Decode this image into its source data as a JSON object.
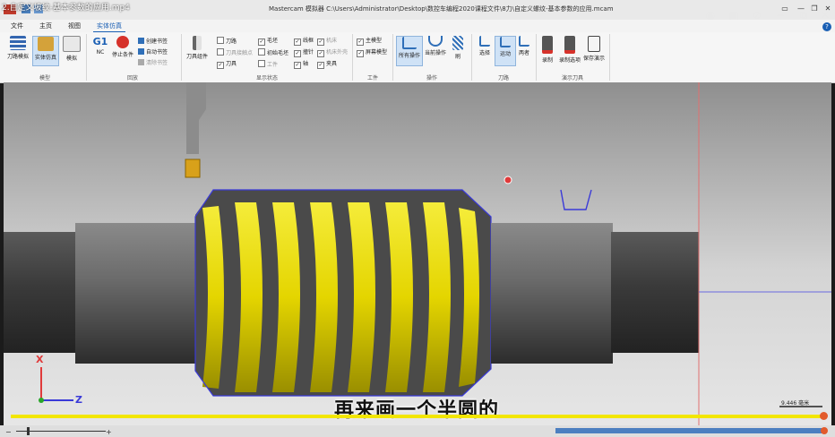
{
  "video": {
    "filename": "2.自定义坡纹-基本参数的应用.mp4",
    "overlay_icons": [
      "camera-icon",
      "picture-in-picture-icon",
      "mute-icon",
      "minimize-icon",
      "restore-icon",
      "close-icon"
    ],
    "progress": 0.985
  },
  "window": {
    "title": "Mastercam 模拟器  C:\\Users\\Administrator\\Desktop\\数控车编程2020课程文件\\8力\\自定义螺纹-基本参数的应用.mcam",
    "help": "?"
  },
  "menu": {
    "items": [
      "文件",
      "主页",
      "视图",
      "实体仿真"
    ],
    "active_index": 3
  },
  "ribbon": {
    "model_group": {
      "label": "模型",
      "buttons": [
        "刀路模拟",
        "实体仿真",
        "模拟"
      ]
    },
    "playback_group": {
      "label": "回放",
      "buttons": [
        "G1",
        "NC",
        "停止条件"
      ],
      "items": [
        "创建书签",
        "自动书签",
        "清除书签"
      ]
    },
    "display_group": {
      "label": "显示状态",
      "tool_label": "刀具组件",
      "checks": [
        {
          "label": "刀路",
          "checked": false,
          "disabled": false
        },
        {
          "label": "刀具接触点",
          "checked": false,
          "disabled": true
        },
        {
          "label": "刀具",
          "checked": true,
          "disabled": false
        },
        {
          "label": "毛坯",
          "checked": true,
          "disabled": false
        },
        {
          "label": "初始毛坯",
          "checked": false,
          "disabled": false
        },
        {
          "label": "工件",
          "checked": false,
          "disabled": true
        },
        {
          "label": "线框",
          "checked": true,
          "disabled": false
        },
        {
          "label": "撞针",
          "checked": true,
          "disabled": false
        },
        {
          "label": "轴",
          "checked": true,
          "disabled": false
        },
        {
          "label": "机床",
          "checked": true,
          "disabled": true
        },
        {
          "label": "机床外壳",
          "checked": true,
          "disabled": true
        },
        {
          "label": "夹具",
          "checked": true,
          "disabled": false
        }
      ]
    },
    "workpiece_group": {
      "label": "工件",
      "checks": [
        {
          "label": "主模型",
          "checked": true
        },
        {
          "label": "屏幕模型",
          "checked": true
        }
      ]
    },
    "operation_group": {
      "label": "操作",
      "buttons": [
        "所有操作",
        "当前操作",
        "刷"
      ]
    },
    "toolpath_group": {
      "label": "刀路",
      "buttons": [
        "选择",
        "运动",
        "两者"
      ]
    },
    "demo_group": {
      "label": "演示刀具",
      "buttons": [
        "录制",
        "录制选项",
        "保存演示"
      ]
    }
  },
  "viewport": {
    "axis_x_label": "X",
    "axis_z_label": "Z",
    "scale_label": "9.446 毫米",
    "caption": "再来画一个半圆的",
    "thread_color": "#f0e600",
    "accent_color": "#3a3ad8"
  }
}
